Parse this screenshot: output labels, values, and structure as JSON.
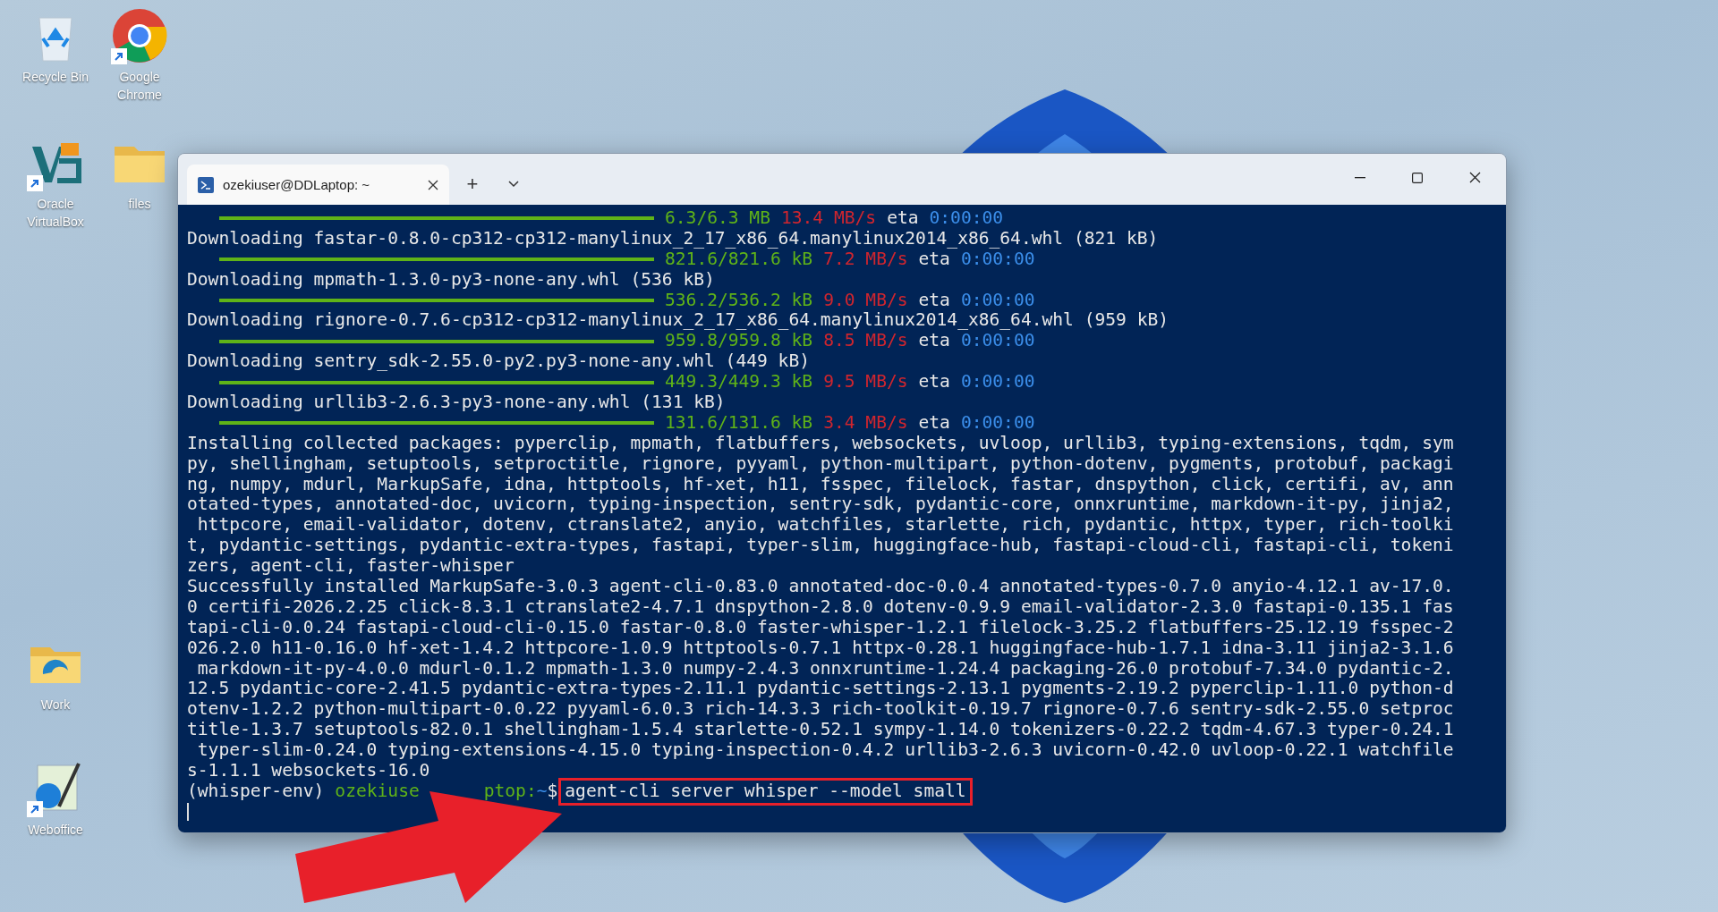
{
  "desktop_icons": [
    {
      "label": "Recycle Bin",
      "kind": "recycle",
      "shortcut": false
    },
    {
      "label": "Google Chrome",
      "kind": "chrome",
      "shortcut": true
    },
    {
      "label": "Oracle VirtualBox",
      "kind": "virtualbox",
      "shortcut": true
    },
    {
      "label": "files",
      "kind": "folder",
      "shortcut": false
    },
    {
      "label": "Work",
      "kind": "folder-edge",
      "shortcut": false
    },
    {
      "label": "Weboffice",
      "kind": "weboffice",
      "shortcut": true
    }
  ],
  "window": {
    "tab": {
      "title": "ozekiuser@DDLaptop: ~",
      "selected": true
    },
    "new_tab": "+"
  },
  "terminal": {
    "lines": [
      {
        "kind": "progress",
        "level": 1,
        "size": "6.3/6.3 MB",
        "speed": "13.4 MB/s",
        "eta_label": "eta",
        "eta": "0:00:00"
      },
      {
        "kind": "text",
        "text": "Downloading fastar-0.8.0-cp312-cp312-manylinux_2_17_x86_64.manylinux2014_x86_64.whl (821 kB)"
      },
      {
        "kind": "progress",
        "level": 1,
        "size": "821.6/821.6 kB",
        "speed": "7.2 MB/s",
        "eta_label": "eta",
        "eta": "0:00:00"
      },
      {
        "kind": "text",
        "text": "Downloading mpmath-1.3.0-py3-none-any.whl (536 kB)"
      },
      {
        "kind": "progress",
        "level": 1,
        "size": "536.2/536.2 kB",
        "speed": "9.0 MB/s",
        "eta_label": "eta",
        "eta": "0:00:00"
      },
      {
        "kind": "text",
        "text": "Downloading rignore-0.7.6-cp312-cp312-manylinux_2_17_x86_64.manylinux2014_x86_64.whl (959 kB)"
      },
      {
        "kind": "progress",
        "level": 1,
        "size": "959.8/959.8 kB",
        "speed": "8.5 MB/s",
        "eta_label": "eta",
        "eta": "0:00:00"
      },
      {
        "kind": "text",
        "text": "Downloading sentry_sdk-2.55.0-py2.py3-none-any.whl (449 kB)"
      },
      {
        "kind": "progress",
        "level": 1,
        "size": "449.3/449.3 kB",
        "speed": "9.5 MB/s",
        "eta_label": "eta",
        "eta": "0:00:00"
      },
      {
        "kind": "text",
        "text": "Downloading urllib3-2.6.3-py3-none-any.whl (131 kB)"
      },
      {
        "kind": "progress",
        "level": 1,
        "size": "131.6/131.6 kB",
        "speed": "3.4 MB/s",
        "eta_label": "eta",
        "eta": "0:00:00"
      },
      {
        "kind": "text",
        "text": "Installing collected packages: pyperclip, mpmath, flatbuffers, websockets, uvloop, urllib3, typing-extensions, tqdm, sym"
      },
      {
        "kind": "text",
        "text": "py, shellingham, setuptools, setproctitle, rignore, pyyaml, python-multipart, python-dotenv, pygments, protobuf, packagi"
      },
      {
        "kind": "text",
        "text": "ng, numpy, mdurl, MarkupSafe, idna, httptools, hf-xet, h11, fsspec, filelock, fastar, dnspython, click, certifi, av, ann"
      },
      {
        "kind": "text",
        "text": "otated-types, annotated-doc, uvicorn, typing-inspection, sentry-sdk, pydantic-core, onnxruntime, markdown-it-py, jinja2,"
      },
      {
        "kind": "text",
        "text": " httpcore, email-validator, dotenv, ctranslate2, anyio, watchfiles, starlette, rich, pydantic, httpx, typer, rich-toolki"
      },
      {
        "kind": "text",
        "text": "t, pydantic-settings, pydantic-extra-types, fastapi, typer-slim, huggingface-hub, fastapi-cloud-cli, fastapi-cli, tokeni"
      },
      {
        "kind": "text",
        "text": "zers, agent-cli, faster-whisper"
      },
      {
        "kind": "text",
        "text": "Successfully installed MarkupSafe-3.0.3 agent-cli-0.83.0 annotated-doc-0.0.4 annotated-types-0.7.0 anyio-4.12.1 av-17.0."
      },
      {
        "kind": "text",
        "text": "0 certifi-2026.2.25 click-8.3.1 ctranslate2-4.7.1 dnspython-2.8.0 dotenv-0.9.9 email-validator-2.3.0 fastapi-0.135.1 fas"
      },
      {
        "kind": "text",
        "text": "tapi-cli-0.0.24 fastapi-cloud-cli-0.15.0 fastar-0.8.0 faster-whisper-1.2.1 filelock-3.25.2 flatbuffers-25.12.19 fsspec-2"
      },
      {
        "kind": "text",
        "text": "026.2.0 h11-0.16.0 hf-xet-1.4.2 httpcore-1.0.9 httptools-0.7.1 httpx-0.28.1 huggingface-hub-1.7.1 idna-3.11 jinja2-3.1.6"
      },
      {
        "kind": "text",
        "text": " markdown-it-py-4.0.0 mdurl-0.1.2 mpmath-1.3.0 numpy-2.4.3 onnxruntime-1.24.4 packaging-26.0 protobuf-7.34.0 pydantic-2."
      },
      {
        "kind": "text",
        "text": "12.5 pydantic-core-2.41.5 pydantic-extra-types-2.11.1 pydantic-settings-2.13.1 pygments-2.19.2 pyperclip-1.11.0 python-d"
      },
      {
        "kind": "text",
        "text": "otenv-1.2.2 python-multipart-0.0.22 pyyaml-6.0.3 rich-14.3.3 rich-toolkit-0.19.7 rignore-0.7.6 sentry-sdk-2.55.0 setproc"
      },
      {
        "kind": "text",
        "text": "title-1.3.7 setuptools-82.0.1 shellingham-1.5.4 starlette-0.52.1 sympy-1.14.0 tokenizers-0.22.2 tqdm-4.67.3 typer-0.24.1"
      },
      {
        "kind": "text",
        "text": " typer-slim-0.24.0 typing-extensions-4.15.0 typing-inspection-0.4.2 urllib3-2.6.3 uvicorn-0.42.0 uvloop-0.22.1 watchfile"
      },
      {
        "kind": "text",
        "text": "s-1.1.1 websockets-16.0"
      }
    ],
    "prompt": {
      "env": "(whisper-env)",
      "user_visible": "ozekiuse",
      "host_visible": "ptop:",
      "path": "~",
      "sign": "$",
      "command": "agent-cli server whisper --model small",
      "command_highlighted": true
    }
  }
}
